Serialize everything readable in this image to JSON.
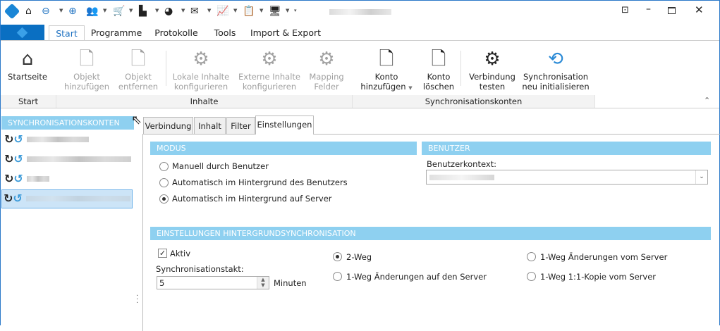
{
  "titlebar": {
    "qat_icons": [
      "app-logo-icon",
      "home-icon",
      "back-icon",
      "forward-icon",
      "contacts-icon",
      "cart-icon",
      "documents-icon",
      "pie-chart-icon",
      "mail-icon",
      "stats-icon",
      "tasks-icon",
      "monitor-icon"
    ],
    "buttons": [
      "restore-icon",
      "minimize-icon",
      "maximize-icon",
      "close-icon"
    ]
  },
  "ribbon": {
    "tabs": [
      "Start",
      "Programme",
      "Protokolle",
      "Tools",
      "Import & Export"
    ],
    "groups": [
      "Start",
      "Inhalte",
      "Synchronisationskonten"
    ],
    "buttons": [
      {
        "l1": "Startseite",
        "l2": "",
        "enabled": true
      },
      {
        "l1": "Objekt",
        "l2": "hinzufügen",
        "enabled": false
      },
      {
        "l1": "Objekt",
        "l2": "entfernen",
        "enabled": false
      },
      {
        "l1": "Lokale Inhalte",
        "l2": "konfigurieren",
        "enabled": false
      },
      {
        "l1": "Externe Inhalte",
        "l2": "konfigurieren",
        "enabled": false
      },
      {
        "l1": "Mapping",
        "l2": "Felder",
        "enabled": false
      },
      {
        "l1": "Konto",
        "l2": "hinzufügen",
        "enabled": true
      },
      {
        "l1": "Konto",
        "l2": "löschen",
        "enabled": true
      },
      {
        "l1": "Verbindung",
        "l2": "testen",
        "enabled": true
      },
      {
        "l1": "Synchronisation",
        "l2": "neu initialisieren",
        "enabled": true
      }
    ]
  },
  "sidebar": {
    "header": "SYNCHRONISATIONSKONTEN"
  },
  "panel": {
    "tabs": [
      "Verbindung",
      "Inhalt",
      "Filter",
      "Einstellungen"
    ],
    "modus": {
      "header": "MODUS",
      "options": [
        "Manuell durch Benutzer",
        "Automatisch im Hintergrund des Benutzers",
        "Automatisch im Hintergrund auf Server"
      ],
      "selected": 2
    },
    "benutzer": {
      "header": "BENUTZER",
      "label": "Benutzerkontext:"
    },
    "sync": {
      "header": "EINSTELLUNGEN HINTERGRUNDSYNCHRONISATION",
      "aktiv_label": "Aktiv",
      "aktiv": true,
      "takt_label": "Synchronisationstakt:",
      "takt_value": "5",
      "unit": "Minuten",
      "options": [
        "2-Weg",
        "1-Weg Änderungen auf den Server",
        "1-Weg Änderungen vom Server",
        "1-Weg 1:1-Kopie vom Server"
      ],
      "selected": 0
    }
  },
  "colors": {
    "accent": "#0a6fc2",
    "header": "#8ed0f0",
    "selection": "#cce4f7"
  }
}
